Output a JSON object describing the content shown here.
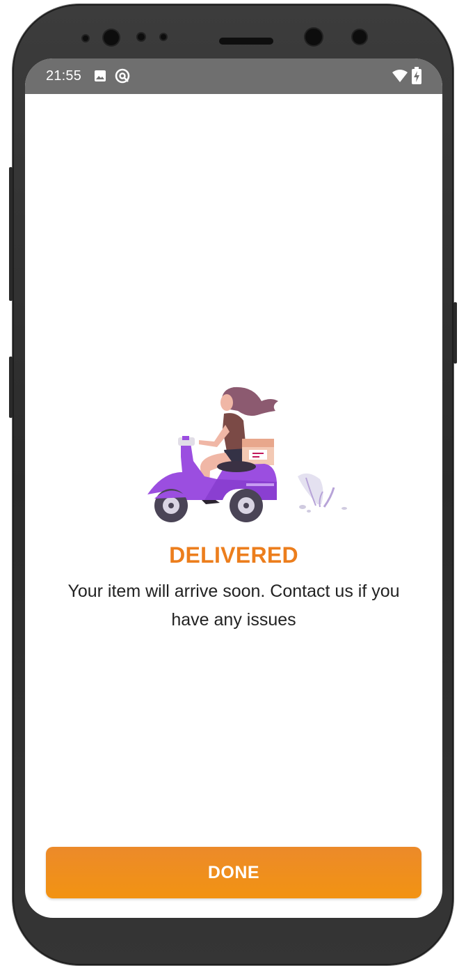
{
  "status_bar": {
    "time": "21:55",
    "icons_left": [
      "image-icon",
      "sync-icon"
    ],
    "icons_right": [
      "wifi-icon",
      "battery-charging-icon"
    ]
  },
  "delivery": {
    "title": "DELIVERED",
    "message": "Your item will arrive soon. Contact us if you have any issues"
  },
  "actions": {
    "done_label": "DONE"
  },
  "colors": {
    "accent": "#EC7E1D",
    "button": "#F29312",
    "status_bar": "#6F6F6F",
    "scooter": "#9B4EE0"
  }
}
